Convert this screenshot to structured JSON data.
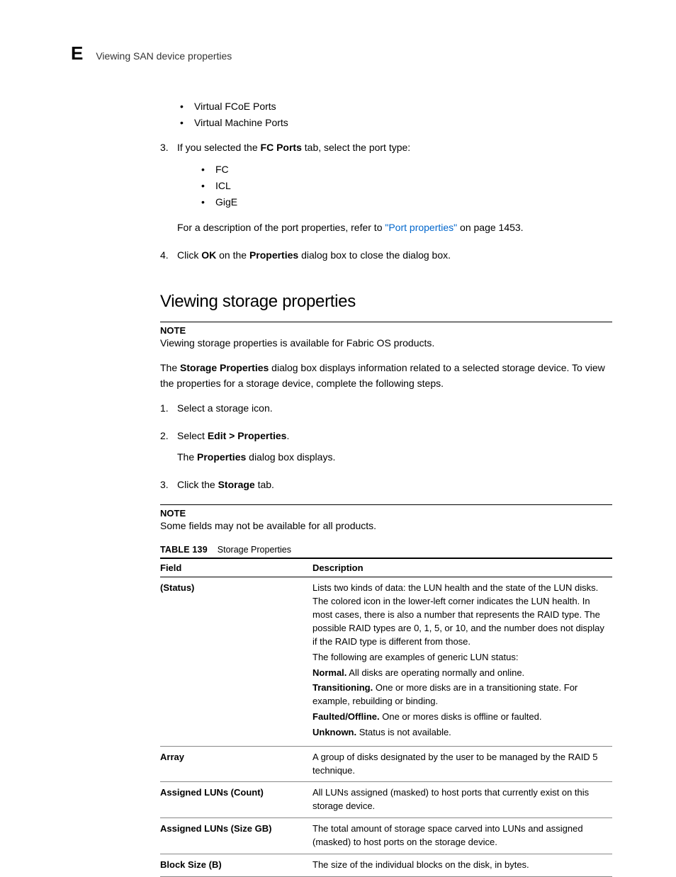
{
  "header": {
    "appendix_letter": "E",
    "title": "Viewing SAN device properties"
  },
  "bullets_top": [
    "Virtual FCoE Ports",
    "Virtual Machine Ports"
  ],
  "step3": {
    "number": "3.",
    "pre": "If you selected the ",
    "bold": "FC Ports",
    "post": " tab, select the port type:"
  },
  "bullets_fc": [
    "FC",
    "ICL",
    "GigE"
  ],
  "step3_ref": {
    "pre": "For a description of the port properties, refer to ",
    "link": "\"Port properties\"",
    "post": " on page 1453."
  },
  "step4": {
    "number": "4.",
    "pre": "Click ",
    "b1": "OK",
    "mid": " on the ",
    "b2": "Properties",
    "post": " dialog box to close the dialog box."
  },
  "section_heading": "Viewing storage properties",
  "note1": {
    "label": "NOTE",
    "text": "Viewing storage properties is available for Fabric OS products."
  },
  "intro": {
    "pre": "The ",
    "bold": "Storage Properties",
    "post": " dialog box displays information related to a selected storage device. To view the properties for a storage device, complete the following steps."
  },
  "steps_props": {
    "s1": {
      "num": "1.",
      "text": "Select a storage icon."
    },
    "s2": {
      "num": "2.",
      "pre": "Select ",
      "bold": "Edit > Properties",
      "post": "."
    },
    "s2_result": {
      "pre": "The ",
      "bold": "Properties",
      "post": " dialog box displays."
    },
    "s3": {
      "num": "3.",
      "pre": "Click the ",
      "bold": "Storage",
      "post": " tab."
    }
  },
  "note2": {
    "label": "NOTE",
    "text": "Some fields may not be available for all products."
  },
  "table": {
    "caption_label": "TABLE 139",
    "caption_title": "Storage Properties",
    "head_field": "Field",
    "head_desc": "Description",
    "rows": [
      {
        "field": "(Status)",
        "desc_parts": [
          {
            "text": "Lists two kinds of data: the LUN health and the state of the LUN disks. The colored icon in the lower-left corner indicates the LUN health. In most cases, there is also a number that represents the RAID type. The possible RAID types are 0, 1, 5, or 10, and the number does not display if the RAID type is different from those."
          },
          {
            "text": "The following are examples of generic LUN status:"
          },
          {
            "bold": "Normal.",
            "rest": " All disks are operating normally and online."
          },
          {
            "bold": "Transitioning.",
            "rest": " One or more disks are in a transitioning state. For example, rebuilding or binding."
          },
          {
            "bold": "Faulted/Offline.",
            "rest": " One or mores disks is offline or faulted."
          },
          {
            "bold": "Unknown.",
            "rest": " Status is not available."
          }
        ]
      },
      {
        "field": "Array",
        "desc": "A group of disks designated by the user to be managed by the RAID 5 technique."
      },
      {
        "field": "Assigned LUNs (Count)",
        "desc": "All LUNs assigned (masked) to host ports that currently exist on this storage device."
      },
      {
        "field": "Assigned LUNs (Size GB)",
        "desc": "The total amount of storage space carved into LUNs and assigned (masked) to host ports on the storage device."
      },
      {
        "field": "Block Size (B)",
        "desc": "The size of the individual blocks on the disk, in bytes."
      }
    ]
  }
}
